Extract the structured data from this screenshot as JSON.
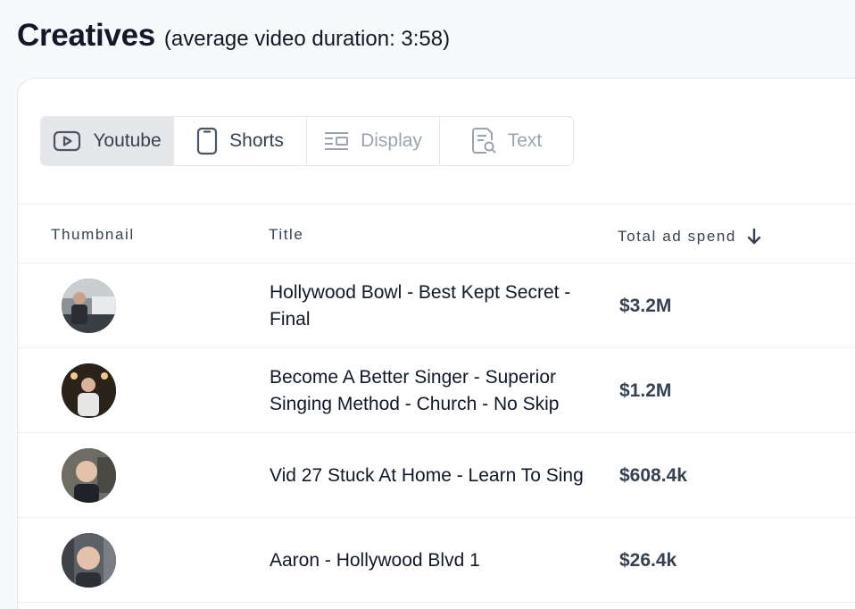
{
  "header": {
    "title": "Creatives",
    "subtitle": "(average video duration: 3:58)"
  },
  "tabs": [
    {
      "label": "Youtube",
      "icon": "youtube-icon",
      "active": true
    },
    {
      "label": "Shorts",
      "icon": "phone-icon",
      "active": false
    },
    {
      "label": "Display",
      "icon": "display-icon",
      "active": false
    },
    {
      "label": "Text",
      "icon": "text-search-icon",
      "active": false
    }
  ],
  "table": {
    "columns": {
      "thumbnail": "Thumbnail",
      "title": "Title",
      "spend": "Total ad spend"
    },
    "sort_icon": "arrow-down-icon",
    "rows": [
      {
        "title": "Hollywood Bowl - Best Kept Secret - Final",
        "spend": "$3.2M"
      },
      {
        "title": "Become A Better Singer - Superior Singing Method - Church - No Skip",
        "spend": "$1.2M"
      },
      {
        "title": "Vid 27 Stuck At Home - Learn To Sing",
        "spend": "$608.4k"
      },
      {
        "title": "Aaron - Hollywood Blvd 1",
        "spend": "$26.4k"
      }
    ]
  },
  "colors": {
    "active_tab_bg": "#e5e7eb",
    "muted_text": "#9ca3af",
    "border": "#e5e7eb"
  }
}
